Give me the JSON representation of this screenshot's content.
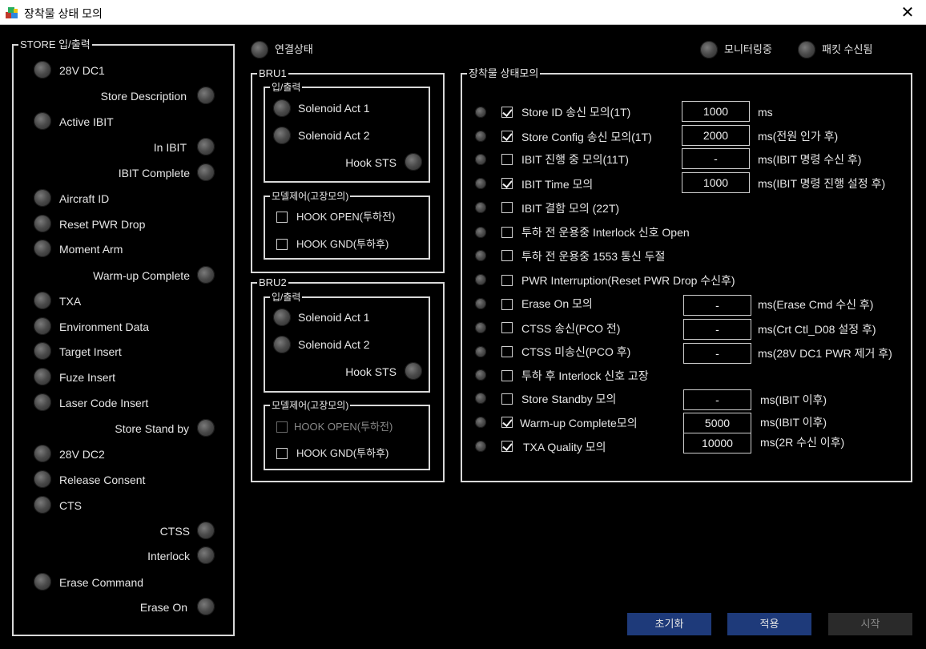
{
  "window": {
    "title": "장착물 상태 모의",
    "close_glyph": "✕"
  },
  "status": {
    "connection": "연결상태",
    "monitoring": "모니터링중",
    "packet": "패킷 수신됨"
  },
  "store_io": {
    "legend": "STORE 입/출력",
    "left_items": [
      "28V DC1",
      "Active IBIT",
      "Aircraft ID",
      "Reset PWR Drop",
      "Moment Arm",
      "TXA",
      "Environment Data",
      "Target Insert",
      "Fuze Insert",
      "Laser Code Insert",
      "28V DC2",
      "Release Consent",
      "CTS",
      "Erase Command"
    ],
    "right_items": [
      "Store Description",
      "In IBIT",
      "IBIT Complete",
      "Warm-up Complete",
      "Store Stand by",
      "CTSS",
      "Interlock",
      "Erase On"
    ]
  },
  "bru1": {
    "legend": "BRU1",
    "io_legend": "입/출력",
    "solenoid1": "Solenoid Act 1",
    "solenoid2": "Solenoid Act 2",
    "hook_sts": "Hook STS",
    "model_legend": "모델제어(고장모의)",
    "hook_open": "HOOK OPEN(투하전)",
    "hook_gnd": "HOOK GND(투하후)"
  },
  "bru2": {
    "legend": "BRU2",
    "io_legend": "입/출력",
    "solenoid1": "Solenoid Act 1",
    "solenoid2": "Solenoid Act 2",
    "hook_sts": "Hook STS",
    "model_legend": "모델제어(고장모의)",
    "hook_open": "HOOK OPEN(투하전)",
    "hook_gnd": "HOOK GND(투하후)"
  },
  "sim": {
    "legend": "장착물 상태모의",
    "rows": [
      {
        "label": "Store ID 송신 모의(1T)",
        "checked": true,
        "value": "1000",
        "unit": "ms"
      },
      {
        "label": "Store Config 송신 모의(1T)",
        "checked": true,
        "value": "2000",
        "unit": "ms(전원 인가 후)"
      },
      {
        "label": "IBIT 진행 중 모의(11T)",
        "checked": false,
        "value": "-",
        "unit": "ms(IBIT 명령 수신 후)"
      },
      {
        "label": "IBIT Time 모의",
        "checked": true,
        "value": "1000",
        "unit": "ms(IBIT 명령 진행 설정 후)"
      },
      {
        "label": "IBIT 결함 모의 (22T)",
        "checked": false
      },
      {
        "label": "투하 전 운용중  Interlock 신호 Open",
        "checked": false
      },
      {
        "label": "투하 전 운용중 1553 통신 두절",
        "checked": false
      },
      {
        "label": "PWR Interruption(Reset PWR Drop 수신후)",
        "checked": false
      },
      {
        "label": "Erase On 모의",
        "checked": false,
        "value": "-",
        "unit": "ms(Erase Cmd 수신 후)"
      },
      {
        "label": "CTSS 송신(PCO 전)",
        "checked": false,
        "value": "-",
        "unit": "ms(Crt Ctl_D08 설정 후)"
      },
      {
        "label": "CTSS 미송신(PCO 후)",
        "checked": false,
        "value": "-",
        "unit": "ms(28V DC1 PWR 제거 후)"
      },
      {
        "label": "투하 후 Interlock 신호 고장",
        "checked": false
      },
      {
        "label": "Store Standby 모의",
        "checked": false,
        "value": "-",
        "unit": "ms(IBIT 이후)"
      },
      {
        "label": "Warm-up Complete모의",
        "checked": true,
        "value": "5000",
        "unit": "ms(IBIT 이후)"
      },
      {
        "label": "TXA Quality 모의",
        "checked": true,
        "value": "10000",
        "unit": "ms(2R 수신 이후)"
      }
    ]
  },
  "buttons": {
    "reset": "초기화",
    "apply": "적용",
    "start": "시작"
  },
  "colors": {
    "background": "#000000",
    "primary_button": "#1e3a7a",
    "disabled_button": "#2a2a2a"
  }
}
